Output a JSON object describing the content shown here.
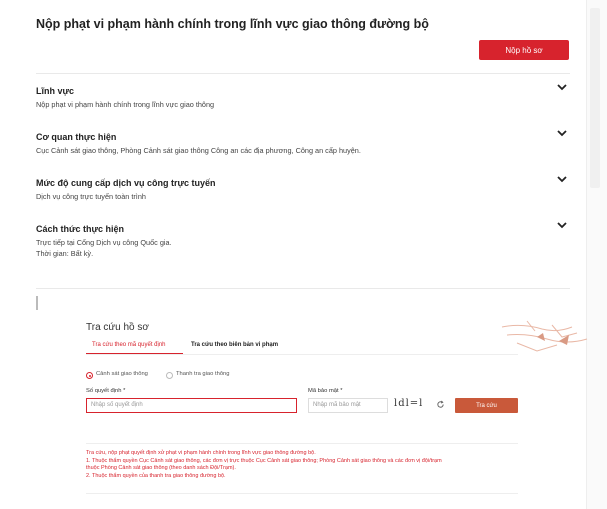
{
  "page": {
    "title": "Nộp phạt vi phạm hành chính trong lĩnh vực giao thông đường bộ",
    "submit_label": "Nộp hồ sơ",
    "accent_color": "#d7232d"
  },
  "sections": [
    {
      "title": "Lĩnh vực",
      "body": [
        "Nộp phạt vi phạm hành chính trong lĩnh vực giao thông"
      ]
    },
    {
      "title": "Cơ quan thực hiện",
      "body": [
        "Cục Cảnh sát giao thông, Phòng Cảnh sát giao thông Công an các địa phương, Công an cấp huyện."
      ]
    },
    {
      "title": "Mức độ cung cấp dịch vụ công trực tuyến",
      "body": [
        "Dịch vụ công trực tuyến toàn trình"
      ]
    },
    {
      "title": "Cách thức thực hiện",
      "body": [
        "Trực tiếp tại Cổng Dịch vụ công Quốc gia.",
        "Thời gian: Bất kỳ."
      ]
    }
  ],
  "lookup": {
    "title": "Tra cứu hồ sơ",
    "tabs": [
      {
        "label": "Tra cứu theo mã quyết định",
        "active": true
      },
      {
        "label": "Tra cứu theo biên bản vi phạm",
        "active": false
      }
    ],
    "radios": [
      {
        "label": "Cảnh sát giao thông",
        "checked": true
      },
      {
        "label": "Thanh tra giao thông",
        "checked": false
      }
    ],
    "decision_label": "Số quyết định *",
    "decision_placeholder": "Nhập số quyết định",
    "captcha_label": "Mã bảo mật *",
    "captcha_placeholder": "Nhập mã bảo mật",
    "captcha_text": "ldl=l",
    "submit_label": "Tra cứu",
    "notes": [
      "Tra cứu, nộp phạt quyết định xử phạt vi phạm hành chính trong lĩnh vực giao thông đường bộ.",
      "1. Thuộc thẩm quyền Cục Cảnh sát giao thông, các đơn vị trực thuộc Cục Cảnh sát giao thông; Phòng Cảnh sát giao thông và các đơn vị đội/trạm",
      "thuộc Phòng Cảnh sát giao thông (theo danh sách Đội/Trạm).",
      "2. Thuộc thẩm quyền của thanh tra giao thông đường bộ."
    ]
  },
  "icons": {
    "chevron": "chevron-down-icon",
    "refresh": "refresh-icon"
  }
}
